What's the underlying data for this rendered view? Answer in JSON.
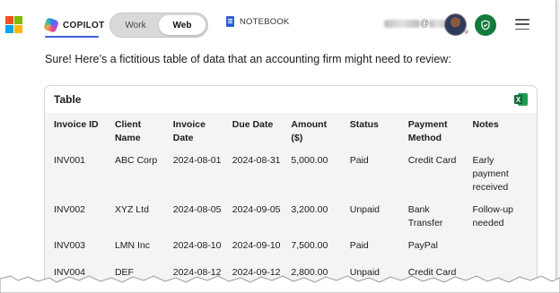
{
  "header": {
    "copilot_label": "COPILOT",
    "toggle": {
      "options": [
        "Work",
        "Web"
      ],
      "selected": "Web"
    },
    "notebook_label": "NOTEBOOK",
    "account_suffix": "@",
    "avatar_badge": "p-p"
  },
  "intro_text": "Sure! Here’s a fictitious table of data that an accounting firm might need to review:",
  "table_card": {
    "title": "Table",
    "columns": [
      "Invoice ID",
      "Client Name",
      "Invoice Date",
      "Due Date",
      "Amount ($)",
      "Status",
      "Payment Method",
      "Notes"
    ],
    "rows": [
      [
        "INV001",
        "ABC Corp",
        "2024-08-01",
        "2024-08-31",
        "5,000.00",
        "Paid",
        "Credit Card",
        "Early payment received"
      ],
      [
        "INV002",
        "XYZ Ltd",
        "2024-08-05",
        "2024-09-05",
        "3,200.00",
        "Unpaid",
        "Bank Transfer",
        "Follow-up needed"
      ],
      [
        "INV003",
        "LMN Inc",
        "2024-08-10",
        "2024-09-10",
        "7,500.00",
        "Paid",
        "PayPal",
        ""
      ],
      [
        "INV004",
        "DEF",
        "2024-08-12",
        "2024-09-12",
        "2,800.00",
        "Unpaid",
        "Credit Card",
        ""
      ]
    ]
  },
  "colors": {
    "accent": "#3a5fd9",
    "shield": "#127a3a",
    "excel": "#1f9a55",
    "table_bg": "#f4f4f4",
    "ms_red": "#f25022",
    "ms_green": "#7fba00",
    "ms_blue": "#00a4ef",
    "ms_yellow": "#ffb900"
  },
  "icons": {
    "logo": "microsoft-logo",
    "copilot": "copilot-icon",
    "notebook": "notebook-icon",
    "shield": "shield-check-icon",
    "menu": "hamburger-menu-icon",
    "excel": "excel-icon"
  }
}
